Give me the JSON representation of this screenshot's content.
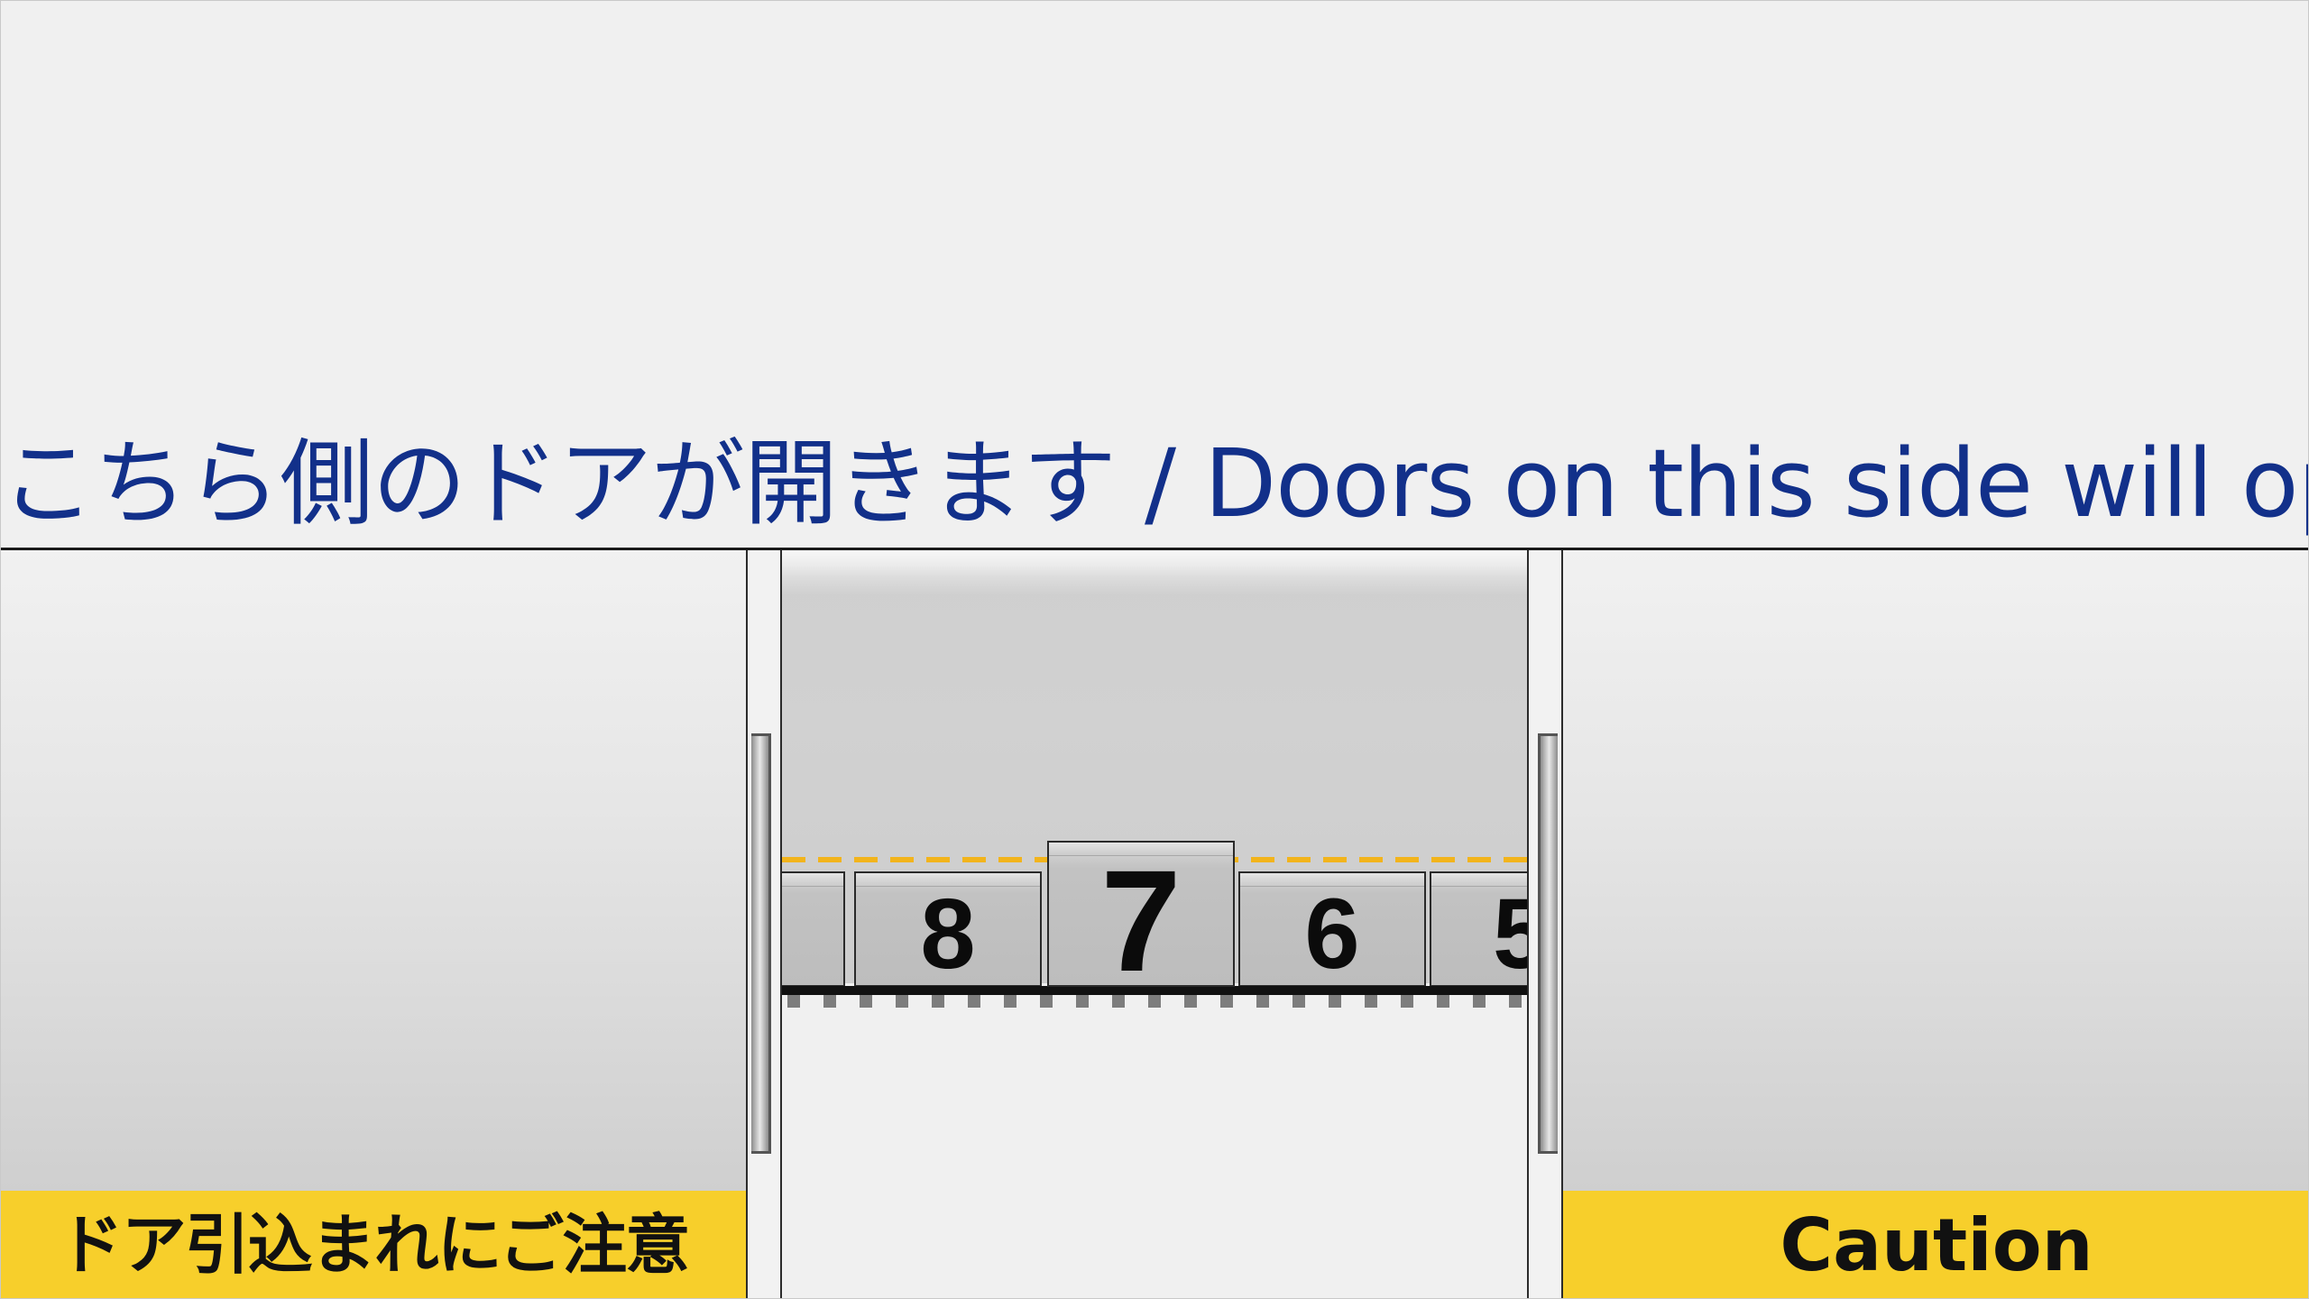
{
  "announcement": {
    "text": "こちら側のドアが開きます / Doors on this side will open."
  },
  "caution": {
    "left_label": "ドア引込まれにご注意",
    "right_label": "Caution",
    "color": "#f7cf2b"
  },
  "floor_indicator": {
    "cards": [
      "8",
      "7",
      "6",
      "5"
    ],
    "current_floor": "7"
  },
  "colors": {
    "announcement_text": "#12308a",
    "dash_line": "#f2b41c",
    "background": "#f0f0f0"
  }
}
